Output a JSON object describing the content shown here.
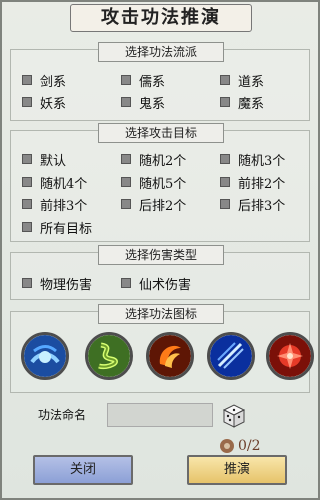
{
  "title": "攻击功法推演",
  "sections": {
    "school": {
      "header": "选择功法流派",
      "options": [
        "剑系",
        "儒系",
        "道系",
        "妖系",
        "鬼系",
        "魔系"
      ]
    },
    "target": {
      "header": "选择攻击目标",
      "options": [
        "默认",
        "随机2个",
        "随机3个",
        "随机4个",
        "随机5个",
        "前排2个",
        "前排3个",
        "后排2个",
        "后排3个",
        "所有目标"
      ]
    },
    "damage": {
      "header": "选择伤害类型",
      "options": [
        "物理伤害",
        "仙术伤害"
      ]
    },
    "icons": {
      "header": "选择功法图标",
      "items": [
        "water-vortex-icon",
        "serpent-icon",
        "flame-claw-icon",
        "blue-slash-icon",
        "red-flower-icon"
      ]
    }
  },
  "name_row": {
    "label": "功法命名",
    "placeholder": ""
  },
  "counter": "0/2",
  "buttons": {
    "close": "关闭",
    "confirm": "推演"
  },
  "colors": {
    "close_button": "#9fb0e0",
    "confirm_button": "#f0d489",
    "checkbox": "#888888"
  }
}
